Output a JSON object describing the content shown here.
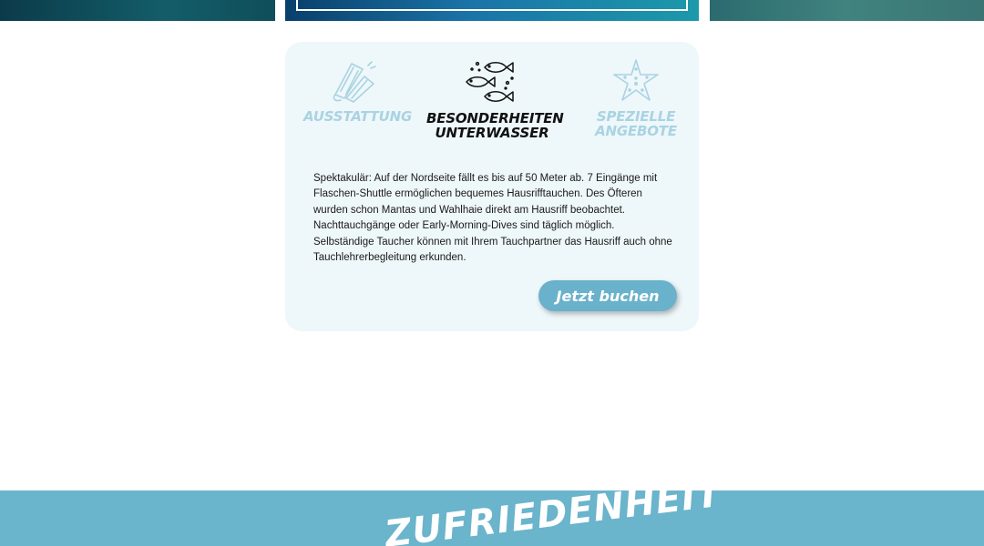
{
  "tabs": [
    {
      "label": "AUSSTATTUNG",
      "icon": "fins-icon",
      "active": false
    },
    {
      "label_line1": "BESONDERHEITEN",
      "label_line2": "UNTERWASSER",
      "icon": "fish-icon",
      "active": true
    },
    {
      "label_line1": "SPEZIELLE",
      "label_line2": "ANGEBOTE",
      "icon": "starfish-icon",
      "active": false
    }
  ],
  "description": {
    "lines": [
      "Spektakulär: Auf der Nordseite fällt es bis auf 50 Meter ab. 7 Eingänge mit",
      "Flaschen-Shuttle ermöglichen bequemes Hausrifftauchen. Des Öfteren",
      "wurden schon Mantas und Wahlhaie direkt am Hausriff beobachtet.",
      "Nachttauchgänge oder Early-Morning-Dives sind täglich möglich.",
      "Selbständige Taucher können mit Ihrem Tauchpartner das Hausriff auch ohne",
      "Tauchlehrerbegleitung erkunden."
    ]
  },
  "book_button": {
    "label": "Jetzt buchen"
  },
  "satisfaction": {
    "heading": "ZUFRIEDENHEIT"
  },
  "colors": {
    "accent": "#6ab4cc",
    "card_bg": "#eef7fa",
    "tab_inactive": "#a9d3e2",
    "tab_active": "#111111"
  }
}
